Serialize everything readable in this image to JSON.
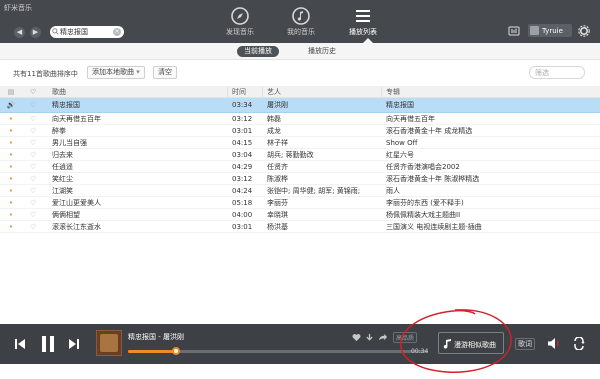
{
  "app": {
    "title": "虾米音乐"
  },
  "header": {
    "search_value": "精忠报国",
    "nav": [
      {
        "label": "发现音乐",
        "icon": "compass-icon"
      },
      {
        "label": "我的音乐",
        "icon": "music-note-icon"
      },
      {
        "label": "播放列表",
        "icon": "playlist-icon",
        "active": true
      }
    ],
    "user_name": "Tyruie"
  },
  "subtabs": [
    {
      "label": "当前播放",
      "active": true
    },
    {
      "label": "播放历史",
      "active": false
    }
  ],
  "toolbar": {
    "count_text": "共有11首歌曲排序中",
    "add_local_label": "添加本地歌曲",
    "clear_label": "清空",
    "filter_placeholder": "筛选"
  },
  "table": {
    "headers": {
      "title": "歌曲",
      "time": "时间",
      "artist": "艺人",
      "album": "专辑"
    },
    "rows": [
      {
        "title": "精忠报国",
        "time": "03:34",
        "artist": "屠洪刚",
        "album": "精忠报国",
        "playing": true
      },
      {
        "title": "向天再借五百年",
        "time": "03:12",
        "artist": "韩磊",
        "album": "向天再借五百年"
      },
      {
        "title": "醉拳",
        "time": "03:01",
        "artist": "成龙",
        "album": "滚石香港黄金十年 成龙精选"
      },
      {
        "title": "男儿当自强",
        "time": "04:15",
        "artist": "林子祥",
        "album": "Show Off"
      },
      {
        "title": "归去来",
        "time": "03:04",
        "artist": "胡兵; 蒋勤勤改",
        "album": "红星六号"
      },
      {
        "title": "任逍遥",
        "time": "04:29",
        "artist": "任贤齐",
        "album": "任贤齐香港演唱会2002"
      },
      {
        "title": "笑红尘",
        "time": "03:12",
        "artist": "陈淑桦",
        "album": "滚石香港黄金十年 陈淑桦精选"
      },
      {
        "title": "江湖笑",
        "time": "04:24",
        "artist": "张铠中; 周华健; 胡军; 黄锦雨;",
        "album": "雨人"
      },
      {
        "title": "爱江山更爱美人",
        "time": "05:18",
        "artist": "李丽芬",
        "album": "李丽芬的东西 (爱不释手)"
      },
      {
        "title": "俩俩相望",
        "time": "04:00",
        "artist": "幸晓琪",
        "album": "杨佩佩精装大戏主题曲II"
      },
      {
        "title": "滚滚长江东逝水",
        "time": "03:01",
        "artist": "杨洪基",
        "album": "三国演义 电视连续剧主题-插曲"
      }
    ]
  },
  "player": {
    "now_playing": "精忠报国 - 屠洪刚",
    "time": "00:34",
    "progress": 0.16,
    "quality_label": "高品质",
    "roam_label": "漫游相似歌曲",
    "lyric_label": "歌词"
  },
  "colors": {
    "header_bg": "#45494d",
    "player_bg": "#3d4145",
    "accent": "#f08a24",
    "selected_row": "#b9dcf7",
    "annotation": "#d4202a"
  }
}
